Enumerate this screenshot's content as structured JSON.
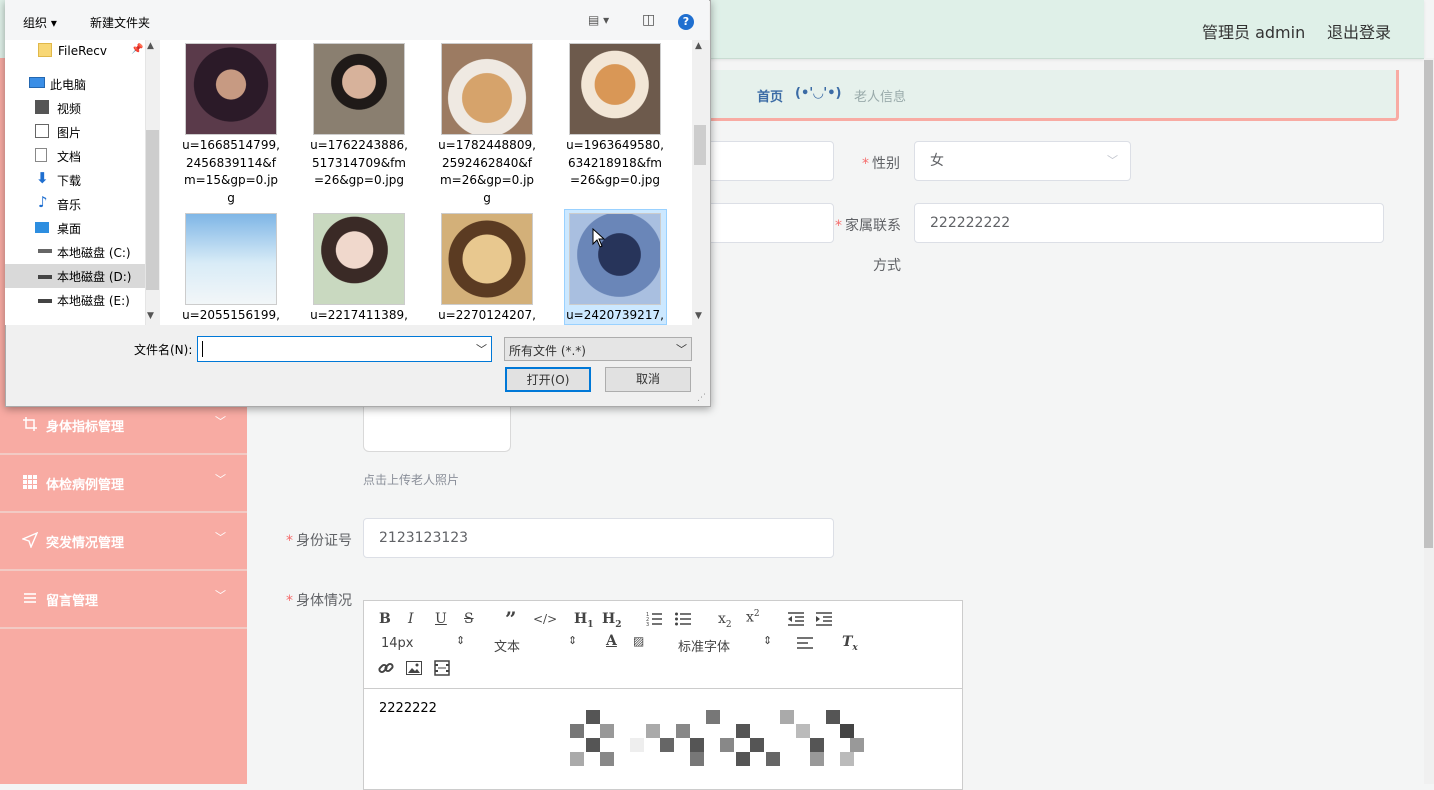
{
  "header": {
    "admin_label": "管理员 admin",
    "logout_label": "退出登录"
  },
  "breadcrumb": {
    "home": "首页",
    "face": "(•'◡'•)",
    "current": "老人信息"
  },
  "sidebar": {
    "items": [
      {
        "label": "身体指标管理",
        "icon": "crop-icon"
      },
      {
        "label": "体检病例管理",
        "icon": "grid-icon"
      },
      {
        "label": "突发情况管理",
        "icon": "navigation-icon"
      },
      {
        "label": "留言管理",
        "icon": "list-icon"
      }
    ]
  },
  "form": {
    "gender_label": "性别",
    "gender_value": "女",
    "family_contact_label": "家属联系",
    "family_contact_label2": "方式",
    "family_contact_value": "222222222",
    "photo_hint": "点击上传老人照片",
    "id_label": "身份证号",
    "id_value": "2123123123",
    "health_label": "身体情况",
    "health_content": "2222222"
  },
  "editor": {
    "font_size": "14px",
    "block_type": "文本",
    "font_family": "标准字体"
  },
  "dialog": {
    "organize": "组织",
    "new_folder": "新建文件夹",
    "nav_items": [
      {
        "label": "FileRecv",
        "icon": "folder-icon"
      },
      {
        "label": "此电脑",
        "icon": "computer-icon"
      },
      {
        "label": "视频",
        "icon": "video-icon"
      },
      {
        "label": "图片",
        "icon": "pictures-icon"
      },
      {
        "label": "文档",
        "icon": "documents-icon"
      },
      {
        "label": "下载",
        "icon": "download-icon"
      },
      {
        "label": "音乐",
        "icon": "music-icon"
      },
      {
        "label": "桌面",
        "icon": "desktop-icon"
      },
      {
        "label": "本地磁盘 (C:)",
        "icon": "drive-icon"
      },
      {
        "label": "本地磁盘 (D:)",
        "icon": "drive-icon"
      },
      {
        "label": "本地磁盘 (E:)",
        "icon": "drive-icon"
      }
    ],
    "files": [
      {
        "name": "u=1668514799,2456839114&fm=15&gp=0.jpg",
        "lines": [
          "u=1668514799,",
          "2456839114&f",
          "m=15&gp=0.jp",
          "g"
        ]
      },
      {
        "name": "u=1762243886,517314709&fm=26&gp=0.jpg",
        "lines": [
          "u=1762243886,",
          "517314709&fm",
          "=26&gp=0.jpg"
        ]
      },
      {
        "name": "u=1782448809,2592462840&fm=26&gp=0.jpg",
        "lines": [
          "u=1782448809,",
          "2592462840&f",
          "m=26&gp=0.jp",
          "g"
        ]
      },
      {
        "name": "u=1963649580,634218918&fm=26&gp=0.jpg",
        "lines": [
          "u=1963649580,",
          "634218918&fm",
          "=26&gp=0.jpg"
        ]
      },
      {
        "name": "u=2055156199,",
        "lines": [
          "u=2055156199,"
        ]
      },
      {
        "name": "u=2217411389,",
        "lines": [
          "u=2217411389,"
        ]
      },
      {
        "name": "u=2270124207,",
        "lines": [
          "u=2270124207,"
        ]
      },
      {
        "name": "u=2420739217,",
        "lines": [
          "u=2420739217,"
        ]
      }
    ],
    "filename_label": "文件名(N):",
    "filename_value": "",
    "filter_value": "所有文件 (*.*)",
    "open_label": "打开(O)",
    "cancel_label": "取消"
  }
}
